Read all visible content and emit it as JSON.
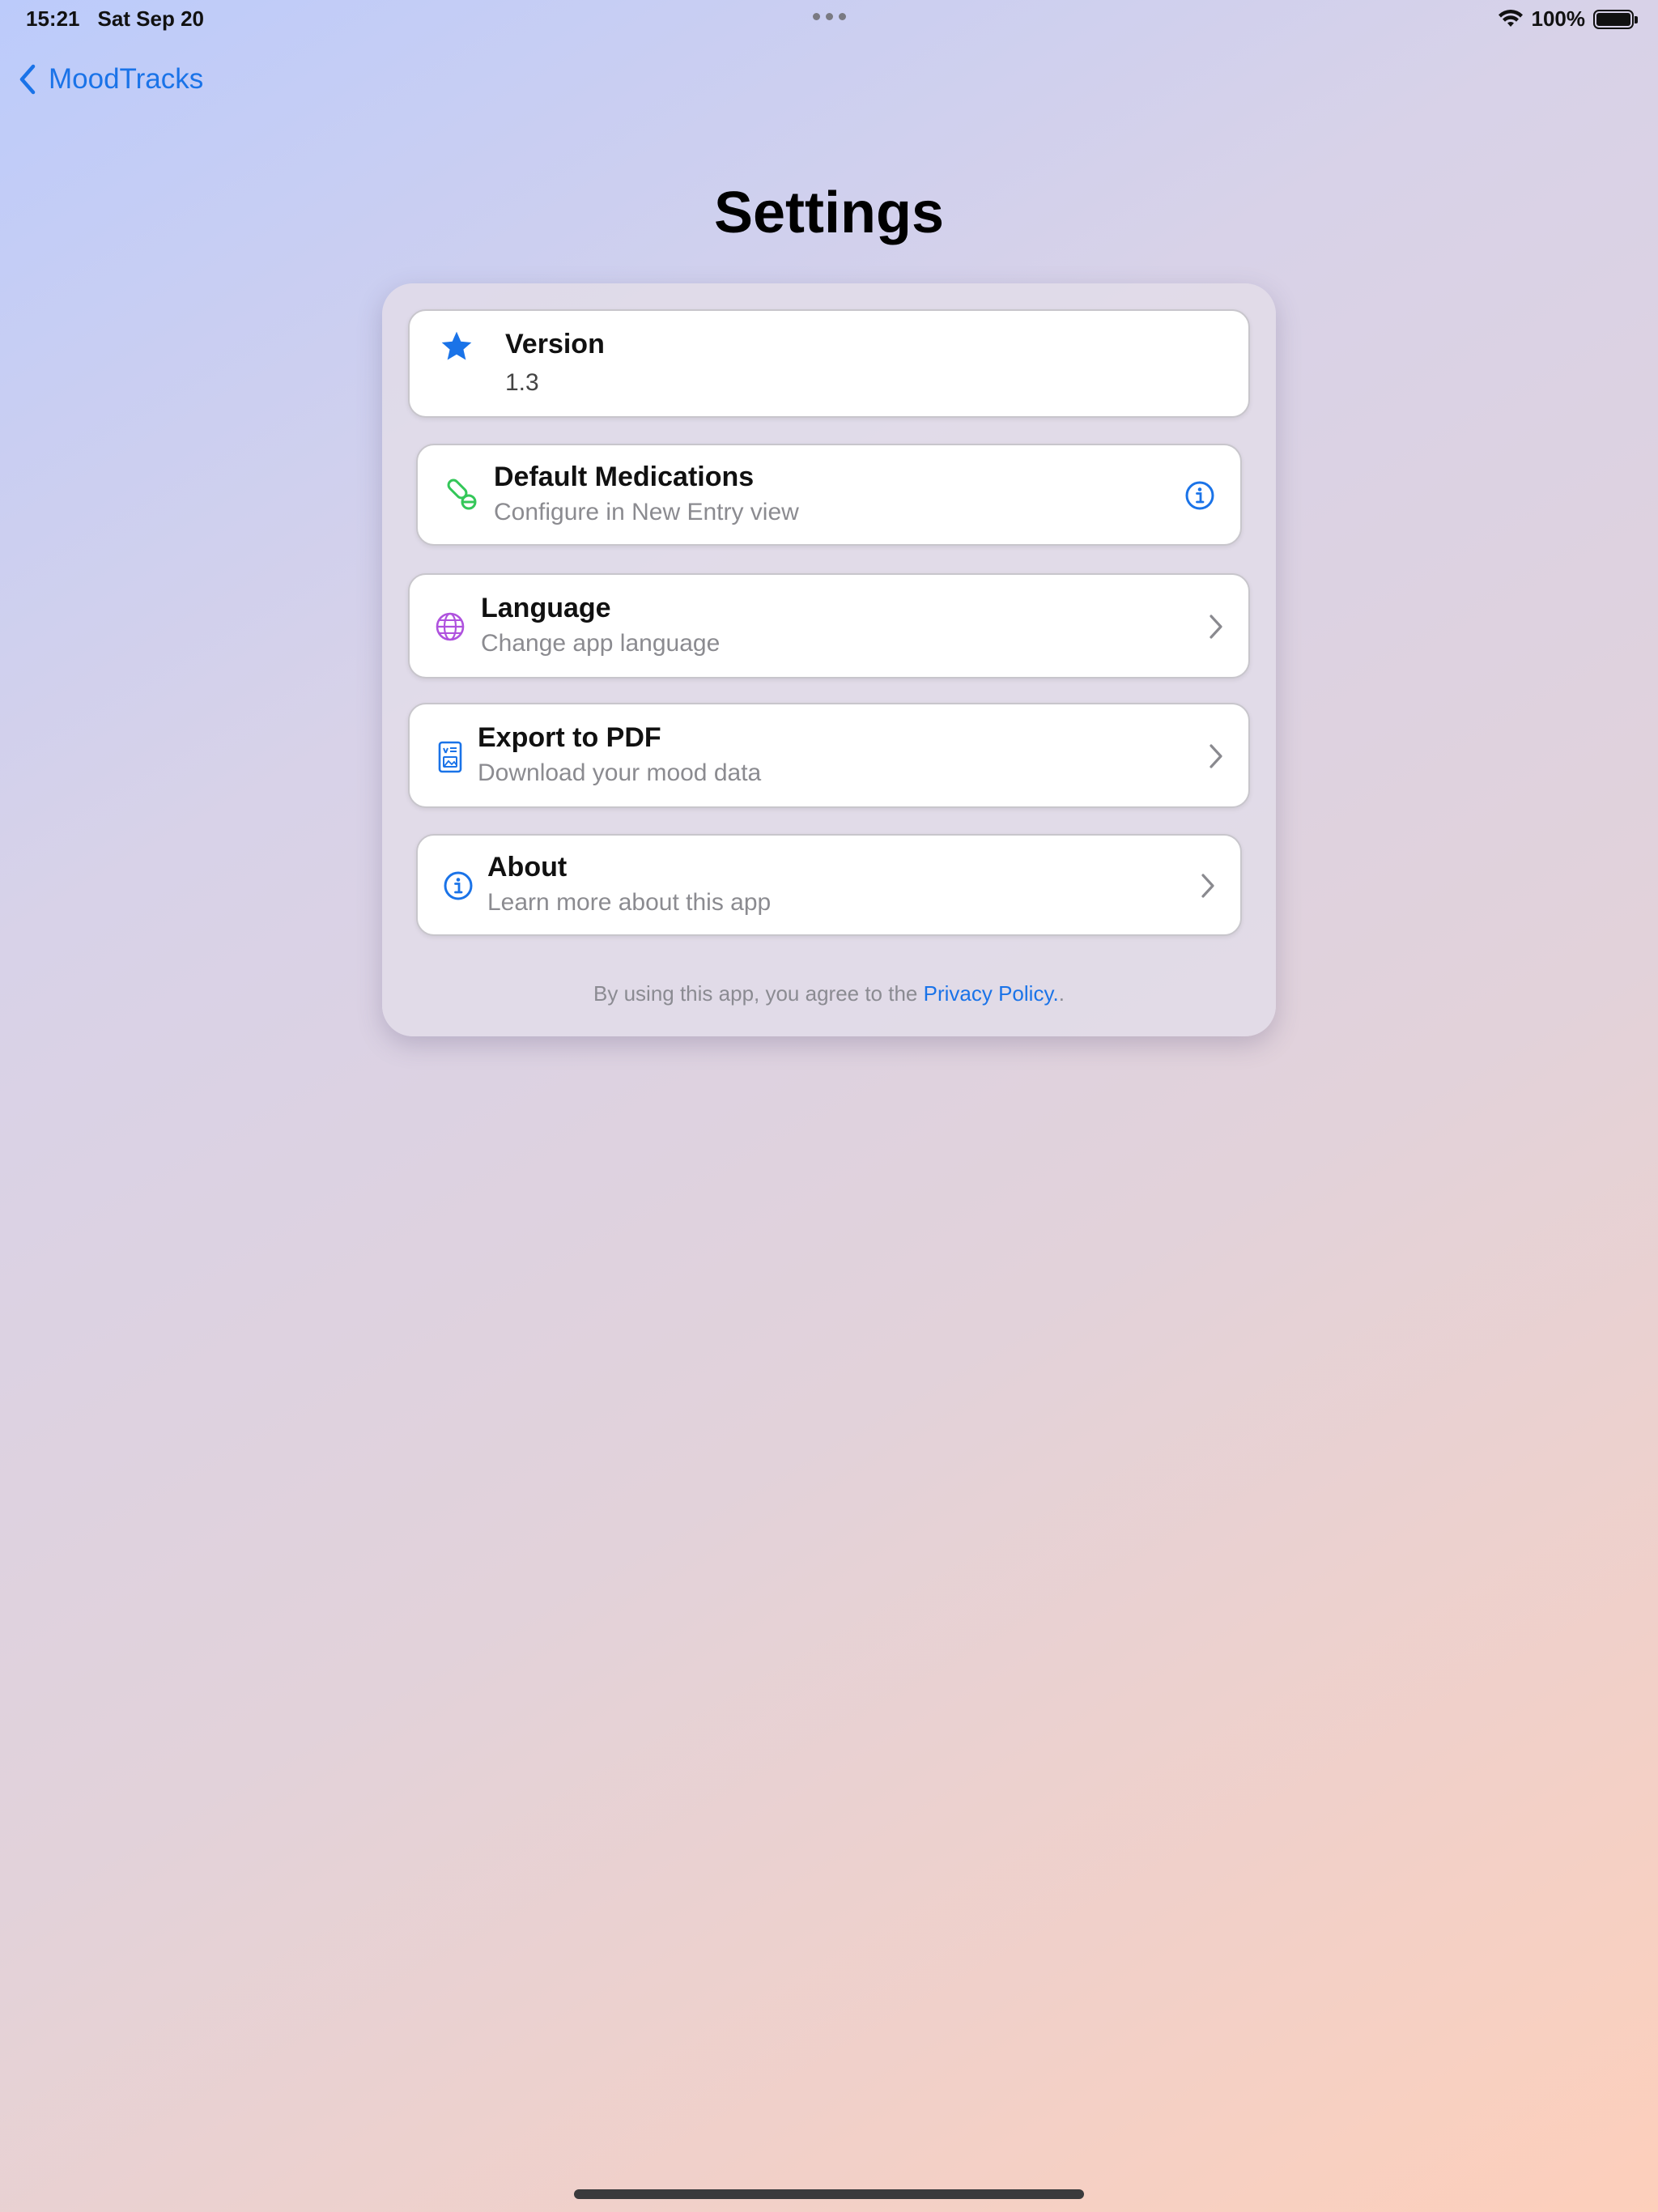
{
  "status_bar": {
    "time": "15:21",
    "date": "Sat Sep 20",
    "battery": "100%"
  },
  "nav": {
    "back_label": "MoodTracks"
  },
  "page": {
    "title": "Settings"
  },
  "rows": [
    {
      "title": "Version",
      "subtitle": "1.3",
      "icon": "star-icon",
      "color": "#1a73e8"
    },
    {
      "title": "Default Medications",
      "subtitle": "Configure in New Entry view",
      "icon": "pills-icon",
      "color": "#34c759",
      "trail": "info-icon"
    },
    {
      "title": "Language",
      "subtitle": "Change app language",
      "icon": "globe-icon",
      "color": "#af52de",
      "trail": "chevron-right-icon"
    },
    {
      "title": "Export to PDF",
      "subtitle": "Download your mood data",
      "icon": "document-icon",
      "color": "#1a73e8",
      "trail": "chevron-right-icon"
    },
    {
      "title": "About",
      "subtitle": "Learn more about this app",
      "icon": "info-icon",
      "color": "#1a73e8",
      "trail": "chevron-right-icon"
    }
  ],
  "footer": {
    "prefix": "By using this app, you agree to the ",
    "link": "Privacy Policy.",
    "suffix": "."
  },
  "colors": {
    "accent": "#1a73e8"
  }
}
